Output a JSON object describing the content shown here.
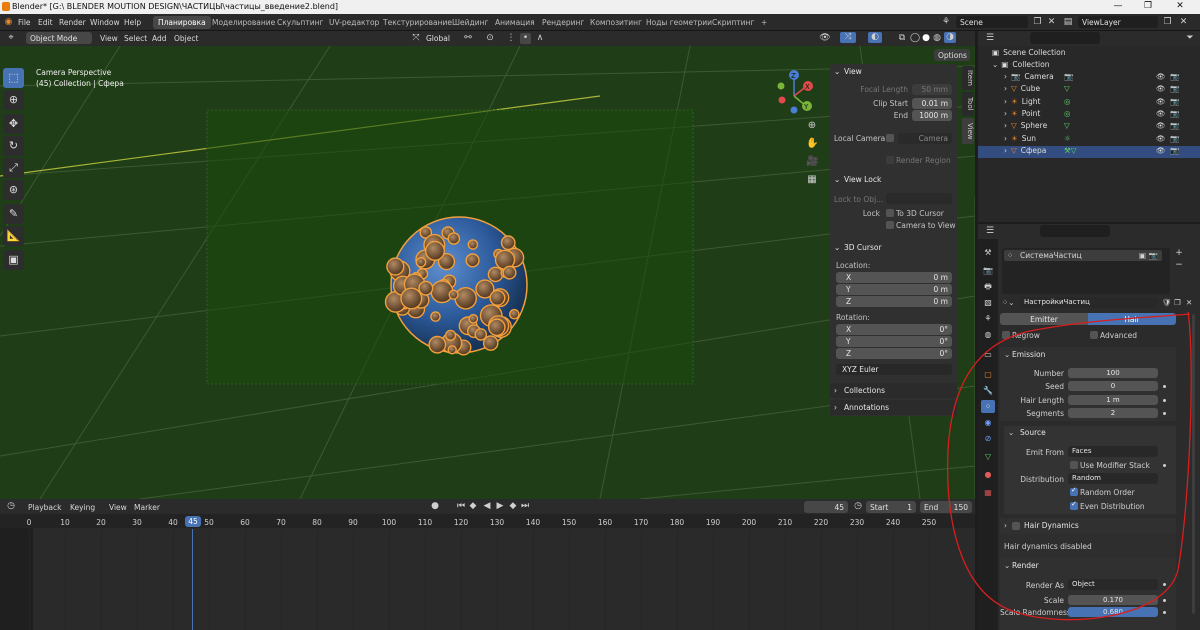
{
  "window": {
    "title": "Blender* [G:\\ BLENDER MOUTION DESIGN\\ЧАСТИЦЫ\\частицы_введение2.blend]",
    "minimize": "—",
    "maximize": "❐",
    "close": "✕"
  },
  "menu": {
    "items": [
      "File",
      "Edit",
      "Render",
      "Window",
      "Help"
    ],
    "workspaces": [
      "Планировка",
      "Моделирование",
      "Скульптинг",
      "UV-редактор",
      "Текстурирование",
      "Шейдинг",
      "Анимация",
      "Рендеринг",
      "Композитинг",
      "Ноды геометрии",
      "Скриптинг"
    ],
    "add_tab": "+",
    "scene": "Scene",
    "view_layer": "ViewLayer"
  },
  "viewport_header": {
    "mode": "Object Mode",
    "menus": [
      "View",
      "Select",
      "Add",
      "Object"
    ],
    "orientation": "Global",
    "options": "Options"
  },
  "viewport": {
    "camera_label": "Camera Perspective",
    "collection_label": "(45) Collection | Сфера",
    "gizmo": {
      "x": "X",
      "y": "Y",
      "z": "Z"
    }
  },
  "npanel": {
    "view": {
      "title": "View",
      "focal_length_label": "Focal Length",
      "focal_length": "50 mm",
      "clip_start_label": "Clip Start",
      "clip_start": "0.01 m",
      "end_label": "End",
      "end": "1000 m",
      "local_camera_label": "Local Camera",
      "local_camera": "Camera",
      "render_region": "Render Region"
    },
    "view_lock": {
      "title": "View Lock",
      "lock_to_obj_label": "Lock to Obj...",
      "lock_label": "Lock",
      "to_3d_cursor": "To 3D Cursor",
      "camera_to_view": "Camera to View"
    },
    "cursor": {
      "title": "3D Cursor",
      "location_label": "Location:",
      "x_label": "X",
      "x": "0 m",
      "y_label": "Y",
      "y": "0 m",
      "z_label": "Z",
      "z": "0 m",
      "rotation_label": "Rotation:",
      "rx": "0°",
      "ry": "0°",
      "rz": "0°",
      "rotation_mode": "XYZ Euler"
    },
    "collections": "Collections",
    "annotations": "Annotations",
    "tabs": [
      "Item",
      "Tool",
      "View"
    ]
  },
  "timeline": {
    "menus": [
      "Playback",
      "Keying",
      "View",
      "Marker"
    ],
    "current_frame": "45",
    "start_label": "Start",
    "start": "1",
    "end_label": "End",
    "end": "150",
    "ticks": [
      "0",
      "10",
      "20",
      "30",
      "40",
      "45",
      "50",
      "60",
      "70",
      "80",
      "90",
      "100",
      "110",
      "120",
      "130",
      "140",
      "150",
      "160",
      "170",
      "180",
      "190",
      "200",
      "210",
      "220",
      "230",
      "240",
      "250"
    ]
  },
  "outliner": {
    "root": "Scene Collection",
    "collection": "Collection",
    "items": [
      "Camera",
      "Cube",
      "Light",
      "Point",
      "Sphere",
      "Sun",
      "Сфера"
    ]
  },
  "properties": {
    "particle_system": "СистемаЧастиц",
    "settings_name": "НастройкиЧастиц",
    "emitter_tab": "Emitter",
    "hair_tab": "Hair",
    "regrow": "Regrow",
    "advanced": "Advanced",
    "emission": {
      "title": "Emission",
      "number_label": "Number",
      "number": "100",
      "seed_label": "Seed",
      "seed": "0",
      "hair_length_label": "Hair Length",
      "hair_length": "1 m",
      "segments_label": "Segments",
      "segments": "2"
    },
    "source": {
      "title": "Source",
      "emit_from_label": "Emit From",
      "emit_from": "Faces",
      "use_modifier_stack": "Use Modifier Stack",
      "distribution_label": "Distribution",
      "distribution": "Random",
      "random_order": "Random Order",
      "even_distribution": "Even Distribution"
    },
    "hair_dynamics": {
      "title": "Hair Dynamics",
      "status": "Hair dynamics disabled"
    },
    "render": {
      "title": "Render",
      "render_as_label": "Render As",
      "render_as": "Object",
      "scale_label": "Scale",
      "scale": "0.170",
      "scale_random_label": "Scale Randomness",
      "scale_random": "0.680"
    }
  },
  "colors": {
    "accent": "#4772b3",
    "viewport_bg": "#1f3d16",
    "selection": "#f2a03d",
    "annotation": "#d81e1e"
  }
}
